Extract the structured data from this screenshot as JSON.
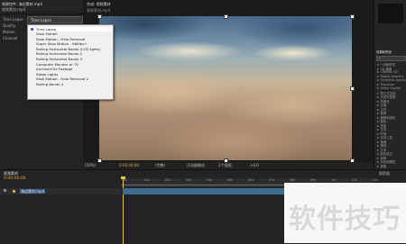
{
  "effect_controls": {
    "tab_label": "效果控件: 海边素材.mp4",
    "layer_label": "视频素材.mp4",
    "rows": [
      {
        "label": "Time Lapse",
        "value": ""
      },
      {
        "label": "Quality",
        "value": ""
      },
      {
        "label": "Motion",
        "value": ""
      },
      {
        "label": "Channel",
        "value": ""
      }
    ]
  },
  "viewer": {
    "tab_label": "合成: 视频素材",
    "zoom": "(50%)",
    "resolution": "(完整)",
    "time": "0:00:00:00",
    "view_label": "活动摄像机",
    "views": "1个视图",
    "exposure": "+0.0"
  },
  "preset_dropdown": {
    "selected": "Time Lapse",
    "items": [
      "Time Lapse",
      "Slow Motion",
      "Slow Motion - Halo Removal",
      "Super Slow Motion - 960fps+",
      "Rolling Horizontal Bands (LCD lights)",
      "Rolling Horizontal Bands 2",
      "Rolling Horizontal Bands 3",
      "Computer Monitor or TV",
      "Archival/Old Footage",
      "Stage Lights",
      "Slow Motion - Halo Removal 2",
      "Rolling Bands 4"
    ]
  },
  "right_panel": {
    "title": "效果和预设",
    "search_placeholder": "",
    "categories": [
      "* 动画预设",
      "3D 通道",
      "CINEMA 4D",
      "Digital Anarchy",
      "Synthetic Aperture",
      "Trapcode",
      "Video Copilot",
      "表达式控制",
      "沉浸式视频",
      "风格化",
      "过渡",
      "过时",
      "抠像",
      "模糊和锐化",
      "模拟",
      "扭曲",
      "生成",
      "时间",
      "实用工具",
      "通道",
      "透视",
      "文本",
      "颜色校正",
      "音频",
      "杂色和颗粒",
      "遮罩"
    ]
  },
  "timeline": {
    "tab_label": "视频素材",
    "current_time": "0:00:00:00",
    "layer_name": "海边素材.mp4",
    "right_label": "跟踪器",
    "ruler_ticks": [
      "0s",
      "01s",
      "02s",
      "03s",
      "04s",
      "05s",
      "06s",
      "07s",
      "08s",
      "09s",
      "10s",
      "11s",
      "12s"
    ]
  },
  "watermark": {
    "text": "软件技巧"
  },
  "colors": {
    "bg": "#1e1e1e",
    "accent": "#2a55c8",
    "playhead": "#e8c24a"
  }
}
